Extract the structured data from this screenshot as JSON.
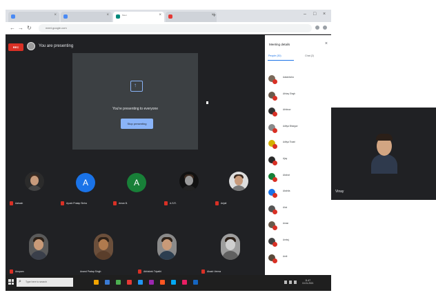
{
  "browser": {
    "tabs": [
      {
        "title": "",
        "active": false
      },
      {
        "title": "",
        "active": false
      },
      {
        "title": "Meet",
        "active": true
      },
      {
        "title": "",
        "active": false
      }
    ],
    "url": "meet.google.com"
  },
  "meet": {
    "recording_badge": "REC",
    "presenting_banner": "You are presenting",
    "presenting_message": "You're presenting to everyone",
    "stop_presenting_label": "Stop presenting"
  },
  "tiles_row1": [
    {
      "name": "Aakash",
      "kind": "photo"
    },
    {
      "name": "Ayush Pratap Sinha",
      "kind": "letter",
      "letter": "A",
      "color": "#1a73e8"
    },
    {
      "name": "Aman B.",
      "kind": "letter",
      "letter": "A",
      "color": "#188038"
    },
    {
      "name": "A.S.R.",
      "kind": "photo"
    },
    {
      "name": "Anjali",
      "kind": "photo"
    }
  ],
  "tiles_row2": [
    {
      "name": "Anupam",
      "kind": "big"
    },
    {
      "name": "Anand Pratap Singh",
      "kind": "big"
    },
    {
      "name": "Abhishek Tripathi",
      "kind": "big"
    },
    {
      "name": "Akash Verma",
      "kind": "big"
    }
  ],
  "panel": {
    "title": "Meeting details",
    "people_tab": "People (30)",
    "chat_tab": "Chat (2)",
    "people": [
      {
        "name": "Aakanksha",
        "color": "#7a6a5a"
      },
      {
        "name": "Abhay Singh",
        "color": "#6b5a4b"
      },
      {
        "name": "Abhinav",
        "color": "#333333"
      },
      {
        "name": "Aditya Bhargav",
        "color": "#8a8a8a"
      },
      {
        "name": "Aditya Tiwari",
        "color": "#d4b000"
      },
      {
        "name": "Ajay",
        "color": "#2a2a2a"
      },
      {
        "name": "Akshat",
        "color": "#188038"
      },
      {
        "name": "Akshita",
        "color": "#1a73e8"
      },
      {
        "name": "Alok",
        "color": "#555555"
      },
      {
        "name": "Aman",
        "color": "#6a5a4a"
      },
      {
        "name": "Ambuj",
        "color": "#444444"
      },
      {
        "name": "Amit",
        "color": "#5a4a3a"
      }
    ]
  },
  "taskbar": {
    "search_placeholder": "Type here to search",
    "icons": [
      "#f2a400",
      "#3a7bd5",
      "#4caf50",
      "#e53935",
      "#2196f3",
      "#9c27b0",
      "#ff5722",
      "#03a9f4",
      "#e91e63",
      "#1565c0"
    ],
    "clock_time": "11:47",
    "clock_date": "10-01-2021"
  },
  "selfview": {
    "name": "Vinay"
  }
}
